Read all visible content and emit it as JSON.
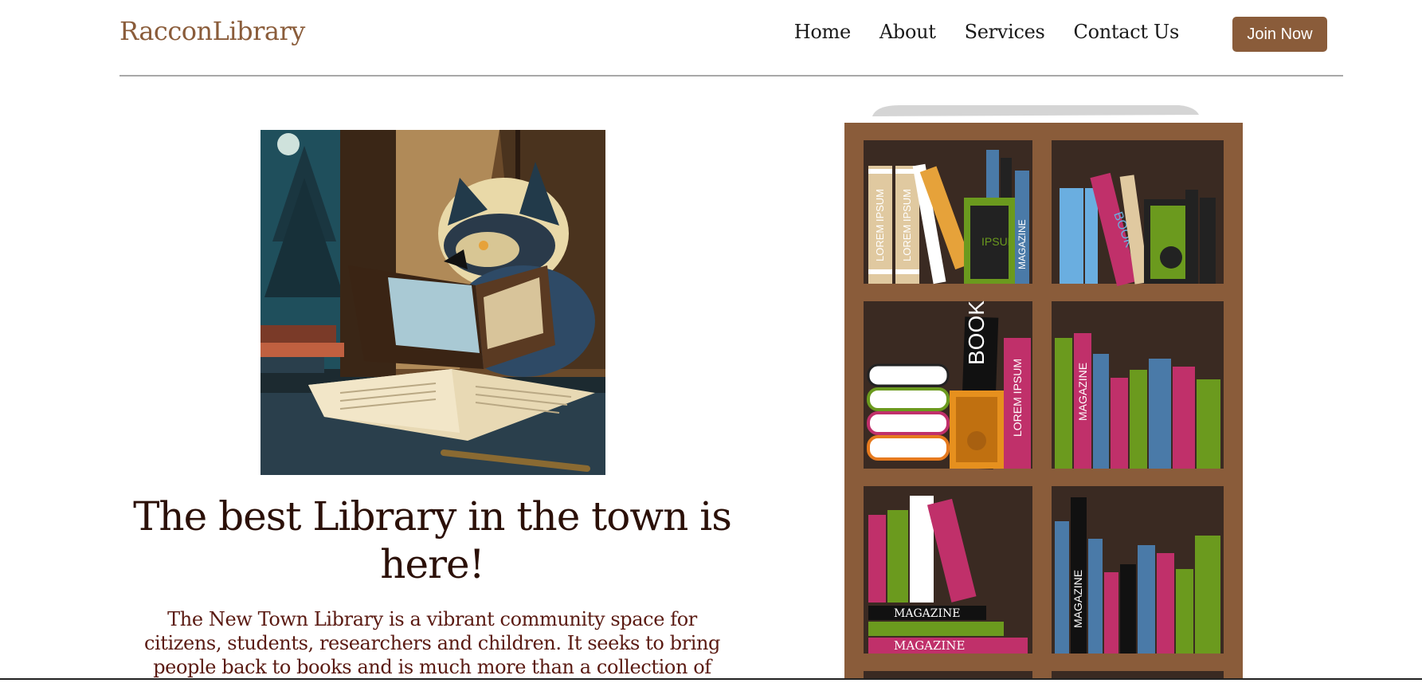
{
  "nav": {
    "brand": "RacconLibrary",
    "links": [
      "Home",
      "About",
      "Services",
      "Contact Us"
    ],
    "cta": "Join Now"
  },
  "hero": {
    "title": "The best Library in the town is here!",
    "description": "The New Town Library is a vibrant community space for citizens, students, researchers and children. It seeks to bring people back to books and is much more than a collection of"
  },
  "bookshelf": {
    "spine_labels": [
      "LOREM IPSUM",
      "IPSUM",
      "MAGAZINE",
      "BOOK",
      "LOREM IPSUM"
    ]
  },
  "colors": {
    "brand": "#8a5c3a",
    "title": "#2b1008",
    "description": "#5a1a12",
    "shelf_frame": "#8a5c3a",
    "shelf_back": "#3a2a22"
  }
}
